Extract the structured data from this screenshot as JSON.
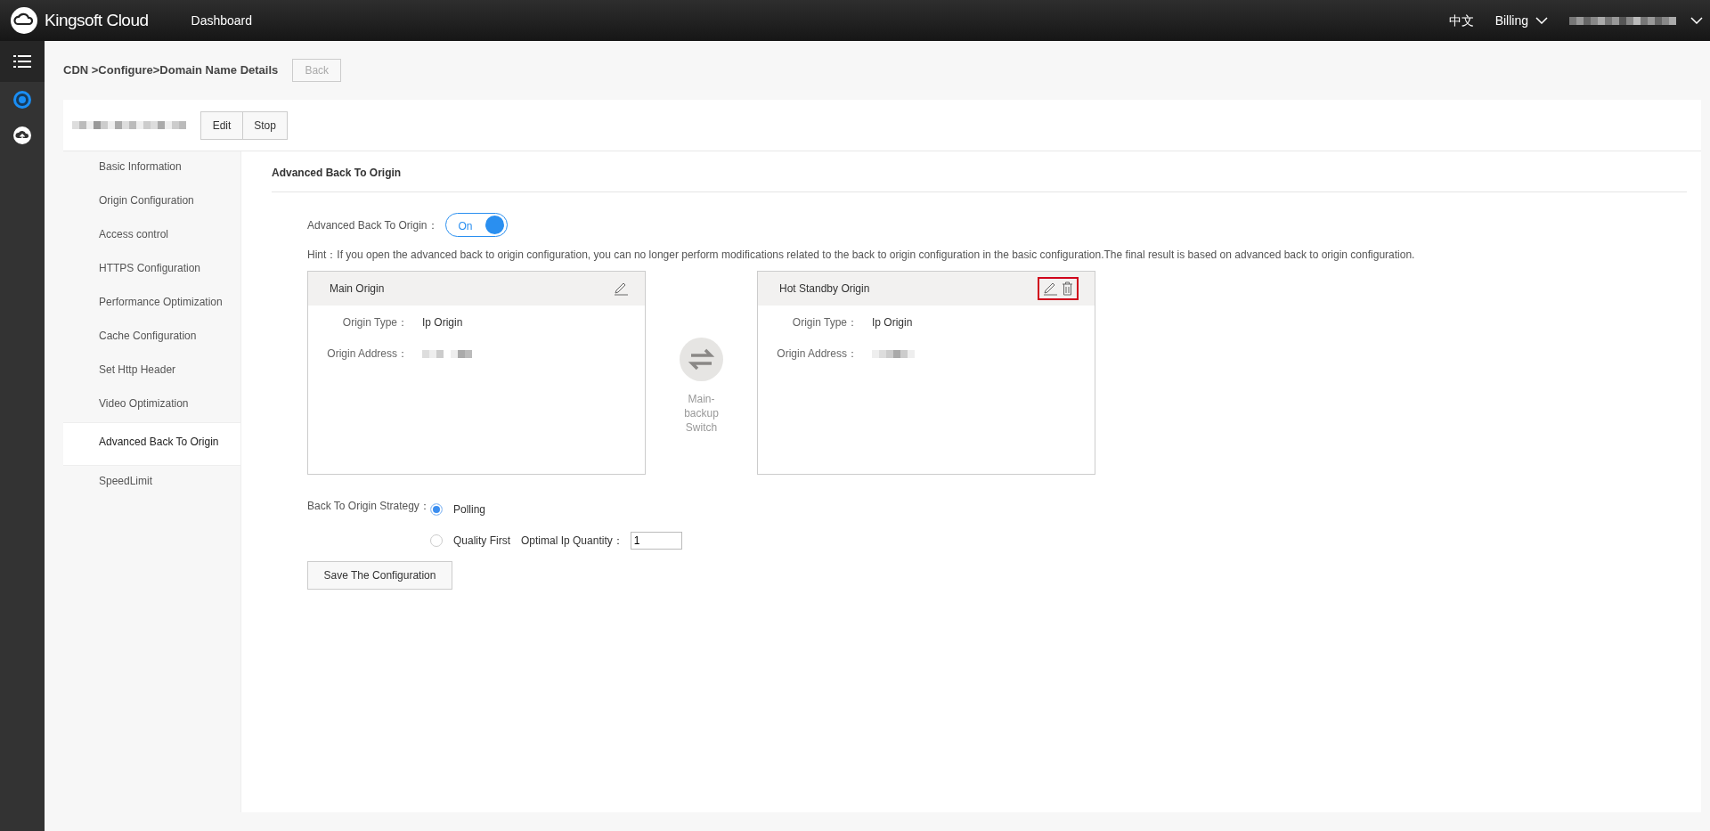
{
  "topbar": {
    "brand": "Kingsoft Cloud",
    "nav": "Dashboard",
    "language": "中文",
    "billing": "Billing"
  },
  "breadcrumb": "CDN >Configure>Domain Name Details",
  "back_button": "Back",
  "domain_actions": [
    "Edit",
    "Stop"
  ],
  "sidebar": [
    {
      "label": "Basic Information",
      "selected": false
    },
    {
      "label": "Origin Configuration",
      "selected": false
    },
    {
      "label": "Access control",
      "selected": false
    },
    {
      "label": "HTTPS Configuration",
      "selected": false
    },
    {
      "label": "Performance Optimization",
      "selected": false
    },
    {
      "label": "Cache Configuration",
      "selected": false
    },
    {
      "label": "Set Http Header",
      "selected": false
    },
    {
      "label": "Video Optimization",
      "selected": false
    },
    {
      "label": "Advanced Back To Origin",
      "selected": true
    },
    {
      "label": "SpeedLimit",
      "selected": false
    }
  ],
  "section_title": "Advanced Back To Origin",
  "advanced": {
    "label": "Advanced Back To Origin：",
    "on": true,
    "toggle_text": "On"
  },
  "hint": "Hint：If you open the advanced back to origin configuration, you can no longer perform modifications related to the back to origin configuration in the basic configuration.The final result is based on advanced back to origin configuration.",
  "origins": [
    {
      "title": "Main Origin",
      "type_label": "Origin Type：",
      "type_value": "Ip Origin",
      "address_label": "Origin Address：",
      "deletable": false,
      "highlighted": false
    },
    {
      "title": "Hot Standby Origin",
      "type_label": "Origin Type：",
      "type_value": "Ip Origin",
      "address_label": "Origin Address：",
      "deletable": true,
      "highlighted": true
    }
  ],
  "switch_label": "Main-backup Switch",
  "strategy": {
    "label": "Back To Origin Strategy：",
    "options": [
      {
        "label": "Polling",
        "selected": true
      },
      {
        "label": "Quality First",
        "selected": false
      }
    ],
    "quantity_label": "Optimal Ip Quantity：",
    "quantity_value": "1"
  },
  "save_button": "Save The Configuration"
}
